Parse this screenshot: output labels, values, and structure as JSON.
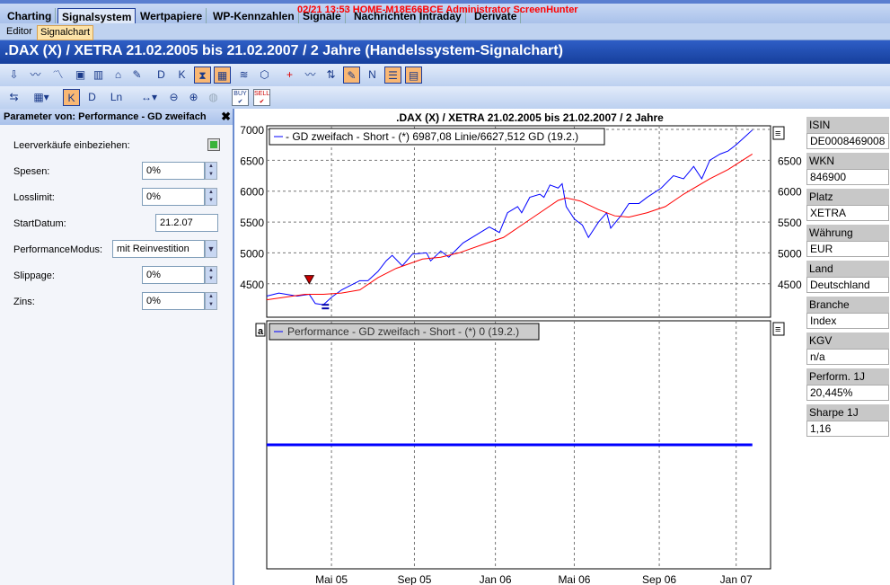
{
  "menu": {
    "tabs": [
      "Charting",
      "Signalsystem",
      "Wertpapiere",
      "WP-Kennzahlen",
      "Signale",
      "Nachrichten",
      "Intraday",
      "Derivate"
    ],
    "overlay": "02/21 13:53 HOME-M18E66BCE Administrator ScreenHunter"
  },
  "subtabs": [
    "Editor",
    "Signalchart"
  ],
  "title": ".DAX (X) / XETRA 21.02.2005 bis 21.02.2007 / 2 Jahre (Handelssystem-Signalchart)",
  "toolbar": {
    "buy": "BUY",
    "sell": "SELL"
  },
  "panel": {
    "title": "Parameter von: Performance - GD zweifach",
    "params": [
      {
        "label": "Leerverkäufe einbeziehen:",
        "value": "checked"
      },
      {
        "label": "Spesen:",
        "value": "0%"
      },
      {
        "label": "Losslimit:",
        "value": "0%"
      },
      {
        "label": "StartDatum:",
        "value": "21.2.07"
      },
      {
        "label": "PerformanceModus:",
        "value": "mit Reinvestition"
      },
      {
        "label": "Slippage:",
        "value": "0%"
      },
      {
        "label": "Zins:",
        "value": "0%"
      }
    ]
  },
  "info": [
    {
      "label": "ISIN",
      "value": "DE0008469008"
    },
    {
      "label": "WKN",
      "value": "846900"
    },
    {
      "label": "Platz",
      "value": "XETRA"
    },
    {
      "label": "Währung",
      "value": "EUR"
    },
    {
      "label": "Land",
      "value": "Deutschland"
    },
    {
      "label": "Branche",
      "value": "Index"
    },
    {
      "label": "KGV",
      "value": "n/a"
    },
    {
      "label": "Perform. 1J",
      "value": "20,445%"
    },
    {
      "label": "Sharpe 1J",
      "value": "1,16"
    }
  ],
  "chart_data": {
    "type": "line",
    "title": ".DAX (X) / XETRA 21.02.2005 bis 21.02.2007 / 2 Jahre",
    "legend_main": "- GD zweifach - Short - (*) 6987,08 Linie/6627,512 GD (19.2.)",
    "legend_perf": "Performance - GD zweifach - Short - (*) 0 (19.2.)",
    "panel_label": "a",
    "xunit": "months since 21.02.2005",
    "xlim": [
      0,
      24.9
    ],
    "ylim": [
      3900,
      7000
    ],
    "yticks_left": [
      "7000",
      "6500",
      "6000",
      "5500",
      "5000",
      "4500"
    ],
    "yticks_left_values": [
      7000,
      6500,
      6000,
      5500,
      5000,
      4500
    ],
    "yticks_right": [
      "6500",
      "6000",
      "5500",
      "5000",
      "4500"
    ],
    "yticks_right_values": [
      6500,
      6000,
      5500,
      5000,
      4500
    ],
    "xticks": [
      {
        "label": "Mai 05",
        "x": 3.2
      },
      {
        "label": "Sep 05",
        "x": 7.3
      },
      {
        "label": "Jan 06",
        "x": 11.3
      },
      {
        "label": "Mai 06",
        "x": 15.2
      },
      {
        "label": "Sep 06",
        "x": 19.4
      },
      {
        "label": "Jan 07",
        "x": 23.2
      }
    ],
    "series": [
      {
        "name": "Linie",
        "color": "#0000ff",
        "points": [
          [
            0,
            4300
          ],
          [
            0.6,
            4350
          ],
          [
            1.5,
            4300
          ],
          [
            2.1,
            4330
          ],
          [
            2.4,
            4180
          ],
          [
            2.8,
            4160
          ],
          [
            3.2,
            4280
          ],
          [
            3.7,
            4400
          ],
          [
            4.6,
            4550
          ],
          [
            5.0,
            4550
          ],
          [
            5.5,
            4700
          ],
          [
            5.9,
            4870
          ],
          [
            6.2,
            4960
          ],
          [
            6.7,
            4790
          ],
          [
            7.2,
            4980
          ],
          [
            7.9,
            5000
          ],
          [
            8.1,
            4870
          ],
          [
            8.6,
            5030
          ],
          [
            9.0,
            4930
          ],
          [
            9.7,
            5160
          ],
          [
            10.4,
            5300
          ],
          [
            11.0,
            5420
          ],
          [
            11.5,
            5330
          ],
          [
            11.9,
            5650
          ],
          [
            12.4,
            5750
          ],
          [
            12.6,
            5650
          ],
          [
            13.0,
            5900
          ],
          [
            13.5,
            5950
          ],
          [
            13.7,
            5900
          ],
          [
            14.0,
            6100
          ],
          [
            14.4,
            6050
          ],
          [
            14.6,
            6120
          ],
          [
            14.8,
            5750
          ],
          [
            15.2,
            5550
          ],
          [
            15.6,
            5450
          ],
          [
            15.9,
            5250
          ],
          [
            16.4,
            5500
          ],
          [
            16.8,
            5650
          ],
          [
            17.0,
            5400
          ],
          [
            17.5,
            5600
          ],
          [
            17.9,
            5800
          ],
          [
            18.4,
            5800
          ],
          [
            18.8,
            5900
          ],
          [
            19.5,
            6050
          ],
          [
            20.1,
            6250
          ],
          [
            20.6,
            6200
          ],
          [
            21.1,
            6400
          ],
          [
            21.5,
            6200
          ],
          [
            21.9,
            6500
          ],
          [
            22.4,
            6600
          ],
          [
            22.8,
            6650
          ],
          [
            23.2,
            6750
          ],
          [
            23.7,
            6900
          ],
          [
            24.0,
            6990
          ]
        ]
      },
      {
        "name": "GD",
        "color": "#ff0000",
        "points": [
          [
            0,
            4240
          ],
          [
            1.9,
            4330
          ],
          [
            2.8,
            4330
          ],
          [
            3.7,
            4350
          ],
          [
            4.6,
            4400
          ],
          [
            5.5,
            4600
          ],
          [
            6.4,
            4750
          ],
          [
            7.7,
            4900
          ],
          [
            8.6,
            4930
          ],
          [
            9.5,
            5000
          ],
          [
            10.8,
            5150
          ],
          [
            11.7,
            5250
          ],
          [
            12.6,
            5450
          ],
          [
            13.5,
            5650
          ],
          [
            14.4,
            5850
          ],
          [
            14.8,
            5890
          ],
          [
            15.5,
            5840
          ],
          [
            16.4,
            5700
          ],
          [
            17.2,
            5600
          ],
          [
            17.9,
            5580
          ],
          [
            18.8,
            5650
          ],
          [
            19.7,
            5750
          ],
          [
            20.6,
            5950
          ],
          [
            21.9,
            6200
          ],
          [
            22.8,
            6350
          ],
          [
            24.0,
            6600
          ]
        ]
      },
      {
        "name": "Performance",
        "color": "#0000ff",
        "points": [
          [
            0,
            0
          ],
          [
            24.0,
            0
          ]
        ]
      }
    ],
    "signals": [
      {
        "type": "sell",
        "x": 2.1,
        "y": 4560
      },
      {
        "type": "exit",
        "x": 2.9,
        "y": 4130
      }
    ]
  }
}
